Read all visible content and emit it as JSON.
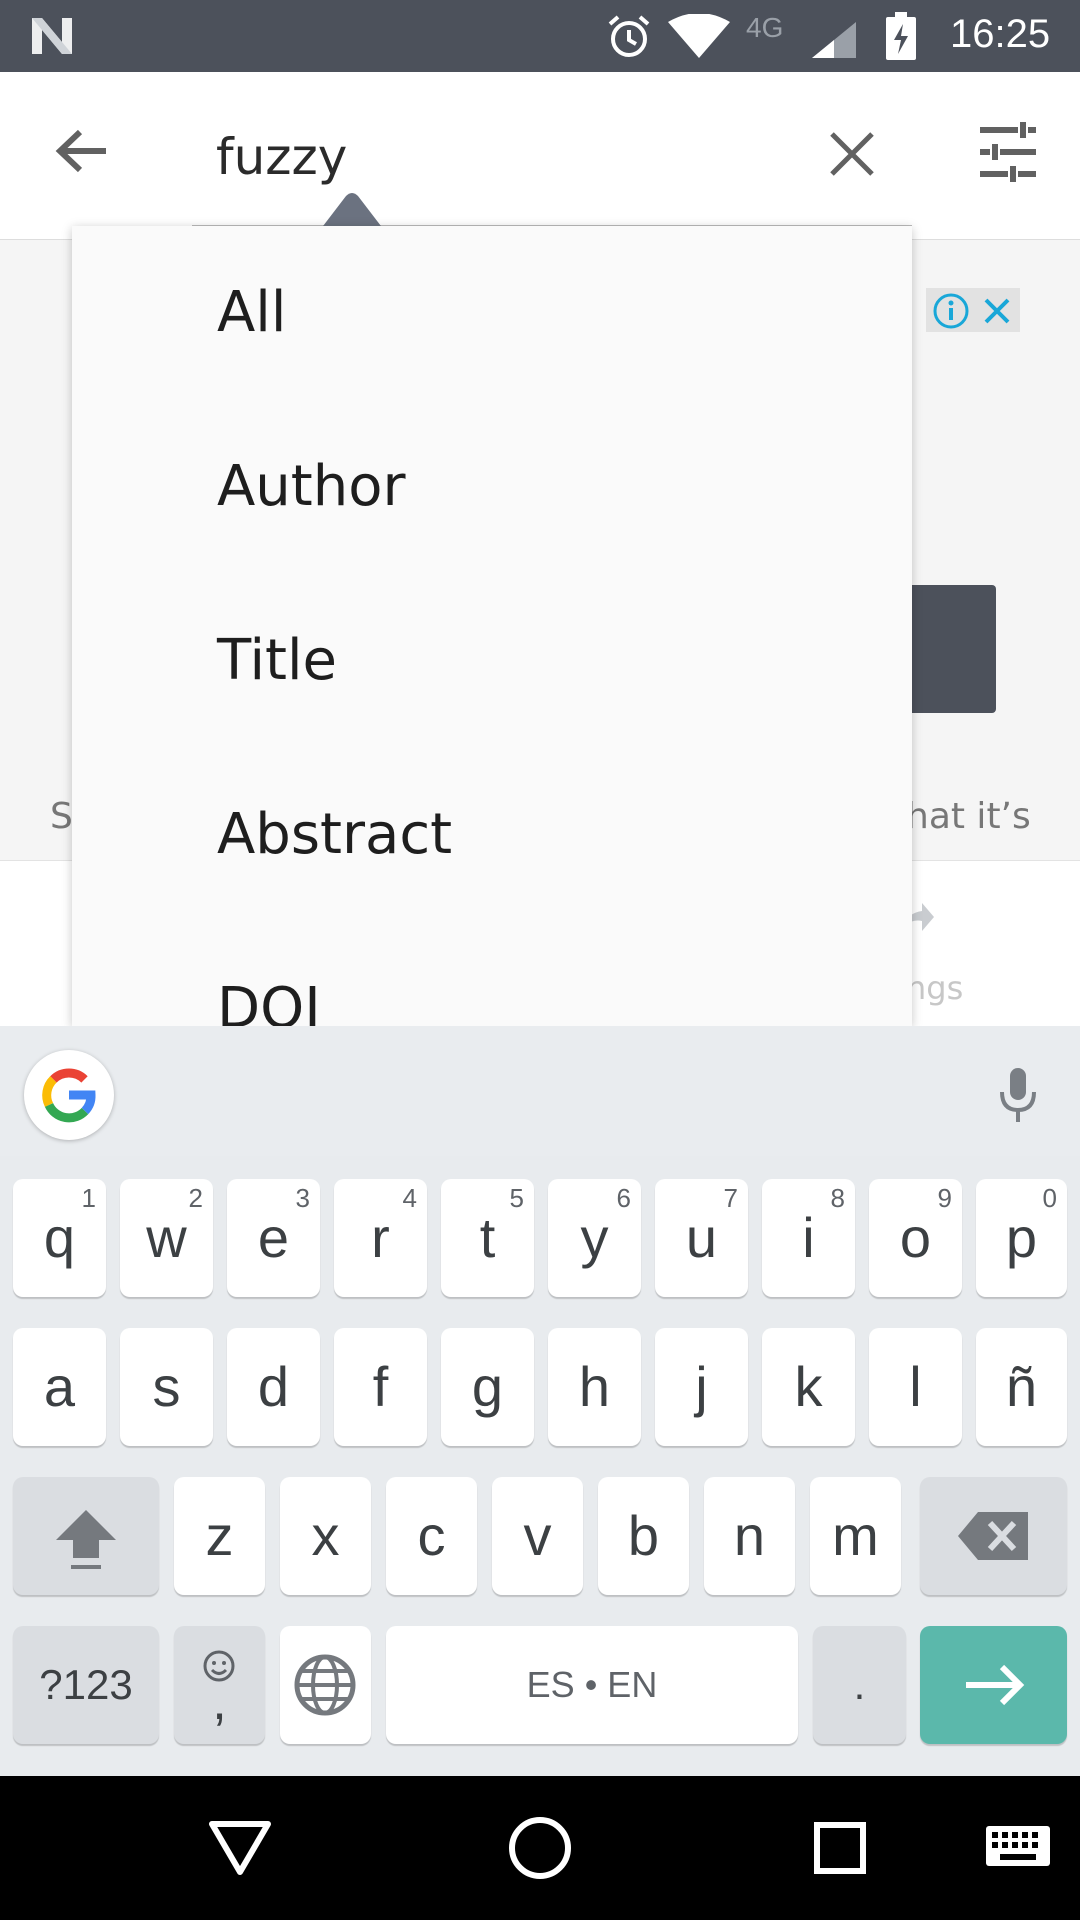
{
  "status_bar": {
    "time": "16:25",
    "network_type": "4G",
    "icons": [
      "n-logo-icon",
      "alarm-icon",
      "wifi-icon",
      "signal-icon",
      "battery-charging-icon"
    ]
  },
  "search": {
    "query": "fuzzy",
    "icons": [
      "back-arrow-icon",
      "close-icon",
      "filter-sliders-icon"
    ]
  },
  "dropdown": {
    "options": [
      "All",
      "Author",
      "Title",
      "Abstract",
      "DOI"
    ]
  },
  "background": {
    "left_snippet": "S",
    "right_snippet": "hat it’s",
    "settings_snippet": "ngs",
    "ad_icons": [
      "info-icon",
      "close-icon"
    ]
  },
  "keyboard": {
    "rows": [
      [
        {
          "label": "q",
          "hint": "1"
        },
        {
          "label": "w",
          "hint": "2"
        },
        {
          "label": "e",
          "hint": "3"
        },
        {
          "label": "r",
          "hint": "4"
        },
        {
          "label": "t",
          "hint": "5"
        },
        {
          "label": "y",
          "hint": "6"
        },
        {
          "label": "u",
          "hint": "7"
        },
        {
          "label": "i",
          "hint": "8"
        },
        {
          "label": "o",
          "hint": "9"
        },
        {
          "label": "p",
          "hint": "0"
        }
      ],
      [
        {
          "label": "a"
        },
        {
          "label": "s"
        },
        {
          "label": "d"
        },
        {
          "label": "f"
        },
        {
          "label": "g"
        },
        {
          "label": "h"
        },
        {
          "label": "j"
        },
        {
          "label": "k"
        },
        {
          "label": "l"
        },
        {
          "label": "ñ"
        }
      ],
      [
        {
          "label": "z"
        },
        {
          "label": "x"
        },
        {
          "label": "c"
        },
        {
          "label": "v"
        },
        {
          "label": "b"
        },
        {
          "label": "n"
        },
        {
          "label": "m"
        }
      ]
    ],
    "symbols_label": "?123",
    "comma_label": ",",
    "space_label": "ES • EN",
    "period_label": ".",
    "enter_color": "#5bb8ab"
  },
  "nav_bar": {
    "icons": [
      "nav-back-icon",
      "nav-home-icon",
      "nav-recents-icon",
      "keyboard-switch-icon"
    ]
  }
}
